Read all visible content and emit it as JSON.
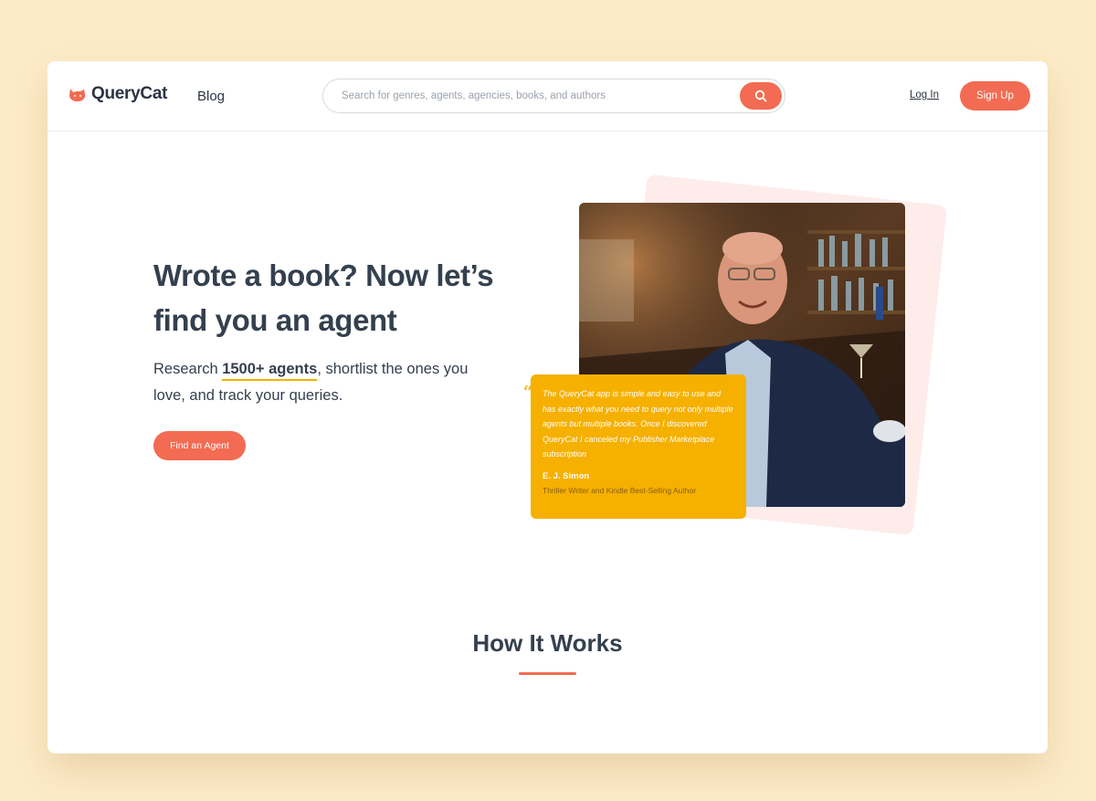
{
  "brand": {
    "name": "QueryCat",
    "accent": "#f26b52",
    "highlight": "#f5b000"
  },
  "nav": {
    "blog_label": "Blog",
    "login_label": "Log In",
    "signup_label": "Sign Up"
  },
  "search": {
    "placeholder": "Search for genres, agents, agencies, books, and authors",
    "icon": "search-icon"
  },
  "hero": {
    "title": "Wrote a book? Now let’s find you an agent",
    "sub_before": "Research ",
    "sub_highlight": "1500+ agents",
    "sub_after": ", shortlist the ones you love, and track your queries.",
    "cta_label": "Find an Agent"
  },
  "testimonial": {
    "quote": "The QueryCat app is simple and easy to use and has exactly what you need to query not only multiple agents but multiple books. Once I discovered QueryCat I canceled my Publisher Marketplace subscription",
    "author": "E. J. Simon",
    "role": "Thriller Writer and Kindle Best-Selling Author"
  },
  "how_it_works": {
    "title": "How It Works"
  }
}
